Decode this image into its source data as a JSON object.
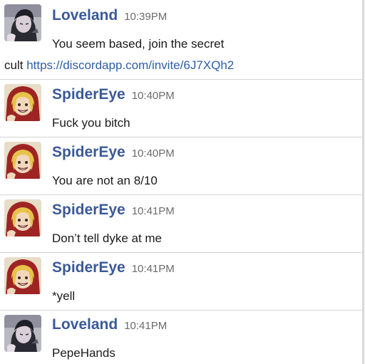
{
  "messages": [
    {
      "user": "Loveland",
      "time": "10:39PM",
      "avatar_icon": "anime-girl-dark-hair-avatar-icon",
      "text_line1": "You seem based, join the secret",
      "text_line2_prefix": "cult",
      "link": "https://discordapp.com/invite/6J7XQh2"
    },
    {
      "user": "SpiderEye",
      "time": "10:40PM",
      "avatar_icon": "blonde-red-hood-avatar-icon",
      "text": "Fuck you bitch"
    },
    {
      "user": "SpiderEye",
      "time": "10:40PM",
      "avatar_icon": "blonde-red-hood-avatar-icon",
      "text": "You are not an 8/10"
    },
    {
      "user": "SpiderEye",
      "time": "10:41PM",
      "avatar_icon": "blonde-red-hood-avatar-icon",
      "text": "Don’t tell dyke at me"
    },
    {
      "user": "SpiderEye",
      "time": "10:41PM",
      "avatar_icon": "blonde-red-hood-avatar-icon",
      "text": "*yell"
    },
    {
      "user": "Loveland",
      "time": "10:41PM",
      "avatar_icon": "anime-girl-dark-hair-avatar-icon",
      "text": "PepeHands"
    }
  ],
  "colors": {
    "username": "#3b5998",
    "timestamp": "#6b6b6b",
    "link": "#2d5ea8",
    "divider": "#d4d4d4"
  }
}
